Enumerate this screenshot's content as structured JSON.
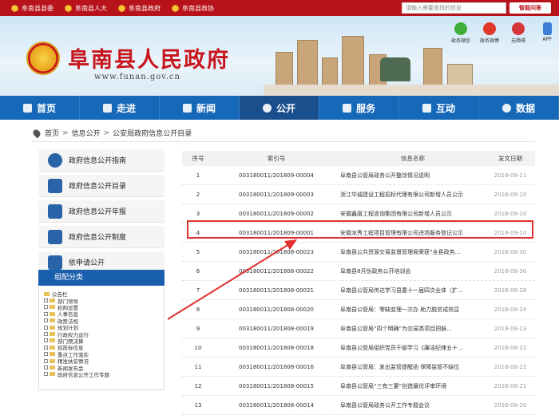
{
  "topbar": {
    "links": [
      "阜南县县委",
      "阜南县人大",
      "阜南县政府",
      "阜南县政协"
    ],
    "search_placeholder": "请输入需要查找的信息",
    "search_button": "智能问答"
  },
  "header": {
    "title": "阜南县人民政府",
    "url": "www.funan.gov.cn",
    "socials": [
      {
        "label": "政务微信",
        "icon": "wechat-icon",
        "color": "#3fae3a"
      },
      {
        "label": "政务微博",
        "icon": "weibo-icon",
        "color": "#e2382b"
      },
      {
        "label": "无障碍",
        "icon": "accessibility-icon",
        "color": "#d6363a"
      },
      {
        "label": "APP",
        "icon": "mobile-app-icon",
        "color": "#3b7dd8"
      }
    ]
  },
  "nav": {
    "items": [
      {
        "label": "首页",
        "icon": "home-icon"
      },
      {
        "label": "走进",
        "icon": "layers-icon"
      },
      {
        "label": "新闻",
        "icon": "grid-icon"
      },
      {
        "label": "公开",
        "icon": "eye-icon"
      },
      {
        "label": "服务",
        "icon": "heart-hand-icon"
      },
      {
        "label": "互动",
        "icon": "chat-icon"
      },
      {
        "label": "数据",
        "icon": "pie-chart-icon"
      }
    ],
    "active": "公开"
  },
  "breadcrumb": {
    "items": [
      "首页",
      "信息公开",
      "公安局政府信息公开目录"
    ],
    "separator": ">"
  },
  "sidebar": {
    "items": [
      {
        "label": "政府信息公开指南",
        "icon": "compass-icon"
      },
      {
        "label": "政府信息公开目录",
        "icon": "list-icon"
      },
      {
        "label": "政府信息公开年报",
        "icon": "document-icon"
      },
      {
        "label": "政府信息公开制度",
        "icon": "file-icon"
      },
      {
        "label": "依申请公开",
        "icon": "form-icon"
      }
    ],
    "category_header": "组配分类",
    "tree": [
      "公告栏",
      "部门领导",
      "机构设置",
      "人事信息",
      "政策法规",
      "规划计划",
      "行政权力运行",
      "部门预决算",
      "招投标信息",
      "重点工作落实",
      "精准扶贫情况",
      "新闻发布会",
      "政府信息公开工作专题"
    ]
  },
  "table": {
    "headers": {
      "no": "序号",
      "id": "索引号",
      "title": "信息名称",
      "date": "发文日期"
    },
    "rows": [
      {
        "no": "1",
        "id": "003180011/201809-00004",
        "title": "阜南县公管局政务公开整改情况说明",
        "date": "2018-09-11"
      },
      {
        "no": "2",
        "id": "003180011/201809-00003",
        "title": "浙江华诚建设工程招标代理有限公司新增人员公示",
        "date": "2018-09-10"
      },
      {
        "no": "3",
        "id": "003180011/201809-00002",
        "title": "安徽鑫唐工程咨询集团有限公司新增人员公示",
        "date": "2018-09-10"
      },
      {
        "no": "4",
        "id": "003180011/201809-00001",
        "title": "安徽龙秀工程项目管理有限公司进场服务登记公示",
        "date": "2018-09-10"
      },
      {
        "no": "5",
        "id": "003180011/201808-00023",
        "title": "阜南县公共资源交易监督管理局荣获“全县政务…",
        "date": "2018-08-30"
      },
      {
        "no": "6",
        "id": "003180011/201808-00022",
        "title": "阜南县8月份政务公开培训会",
        "date": "2018-08-30"
      },
      {
        "no": "7",
        "id": "003180011/201808-00021",
        "title": "阜南县公管局传达学习县委十一届四次全体（扩…",
        "date": "2018-08-28"
      },
      {
        "no": "8",
        "id": "003180011/201808-00020",
        "title": "阜南县公管局：零缺变理一次办 助力脱贫成效显",
        "date": "2018-08-24"
      },
      {
        "no": "9",
        "id": "003180011/201808-00019",
        "title": "阜南县公管局“四个明确”为交易类项目把脉…",
        "date": "2018-08-23"
      },
      {
        "no": "10",
        "id": "003180011/201808-00018",
        "title": "阜南县公管局组织党员干部学习《廉洁纪律五十…",
        "date": "2018-08-22"
      },
      {
        "no": "11",
        "id": "003180011/201808-00016",
        "title": "阜南县公管局：发出监管提醒函 保障监管不缺位",
        "date": "2018-08-22"
      },
      {
        "no": "12",
        "id": "003180011/201808-00015",
        "title": "阜南县公管局“三有三要”创造最优评审环境",
        "date": "2018-08-21"
      },
      {
        "no": "13",
        "id": "003180011/201808-00014",
        "title": "阜南县公管局政务公开工作专题会议",
        "date": "2018-08-20"
      }
    ],
    "highlighted_row": "4"
  },
  "colors": {
    "brand_red": "#b8121b",
    "nav_blue": "#1668b8",
    "highlight": "#e23030"
  }
}
